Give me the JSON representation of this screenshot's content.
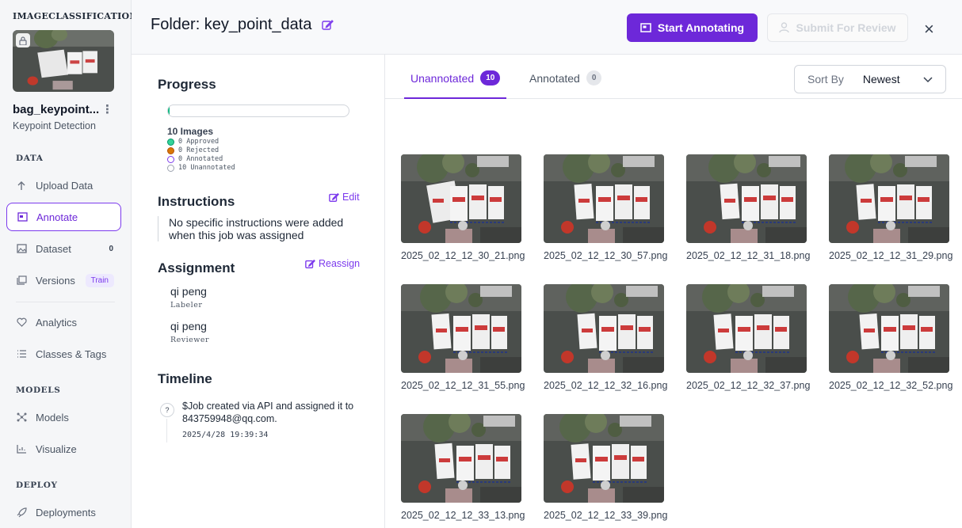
{
  "sidebar": {
    "brand": "IMAGECLASSIFICATION",
    "project_name": "bag_keypoint...",
    "project_type": "Keypoint Detection",
    "sections": {
      "data": "DATA",
      "models": "MODELS",
      "deploy": "DEPLOY"
    },
    "items": [
      {
        "label": "Upload Data",
        "icon": "upload-icon"
      },
      {
        "label": "Annotate",
        "icon": "annotate-icon",
        "active": true
      },
      {
        "label": "Dataset",
        "icon": "image-icon",
        "count": "0"
      },
      {
        "label": "Versions",
        "icon": "layers-icon",
        "tag": "Train"
      },
      {
        "label": "Analytics",
        "icon": "analytics-icon"
      },
      {
        "label": "Classes & Tags",
        "icon": "list-icon"
      },
      {
        "label": "Models",
        "icon": "models-icon"
      },
      {
        "label": "Visualize",
        "icon": "chart-icon"
      },
      {
        "label": "Deployments",
        "icon": "rocket-icon"
      }
    ]
  },
  "header": {
    "title": "Folder: key_point_data",
    "start_label": "Start Annotating",
    "submit_label": "Submit For Review",
    "close": "×"
  },
  "panel": {
    "progress_title": "Progress",
    "progress_fraction": 0.01,
    "images_count": "10 Images",
    "legend": [
      {
        "label": "0 Approved",
        "color": "#34d399"
      },
      {
        "label": "0 Rejected",
        "color": "#d97706"
      },
      {
        "label": "0 Annotated",
        "color": "#7c3aed"
      },
      {
        "label": "10 Unannotated",
        "color": "#9ca3af"
      }
    ],
    "instructions_title": "Instructions",
    "edit_label": "Edit",
    "instructions_text": "No specific instructions were added when this job was assigned",
    "assignment_title": "Assignment",
    "reassign_label": "Reassign",
    "labeler_name": "qi peng",
    "labeler_role": "Labeler",
    "reviewer_name": "qi peng",
    "reviewer_role": "Reviewer",
    "timeline_title": "Timeline",
    "timeline_icon": "?",
    "timeline_text": "$Job created via API and assigned it to 843759948@qq.com.",
    "timeline_time": "2025/4/28 19:39:34"
  },
  "tabs": {
    "unannotated_label": "Unannotated",
    "unannotated_count": "10",
    "annotated_label": "Annotated",
    "annotated_count": "0",
    "sort_label": "Sort By",
    "sort_value": "Newest"
  },
  "images": [
    "2025_02_12_12_30_21.png",
    "2025_02_12_12_30_57.png",
    "2025_02_12_12_31_18.png",
    "2025_02_12_12_31_29.png",
    "2025_02_12_12_31_55.png",
    "2025_02_12_12_32_16.png",
    "2025_02_12_12_32_37.png",
    "2025_02_12_12_32_52.png",
    "2025_02_12_12_33_13.png",
    "2025_02_12_12_33_39.png"
  ]
}
